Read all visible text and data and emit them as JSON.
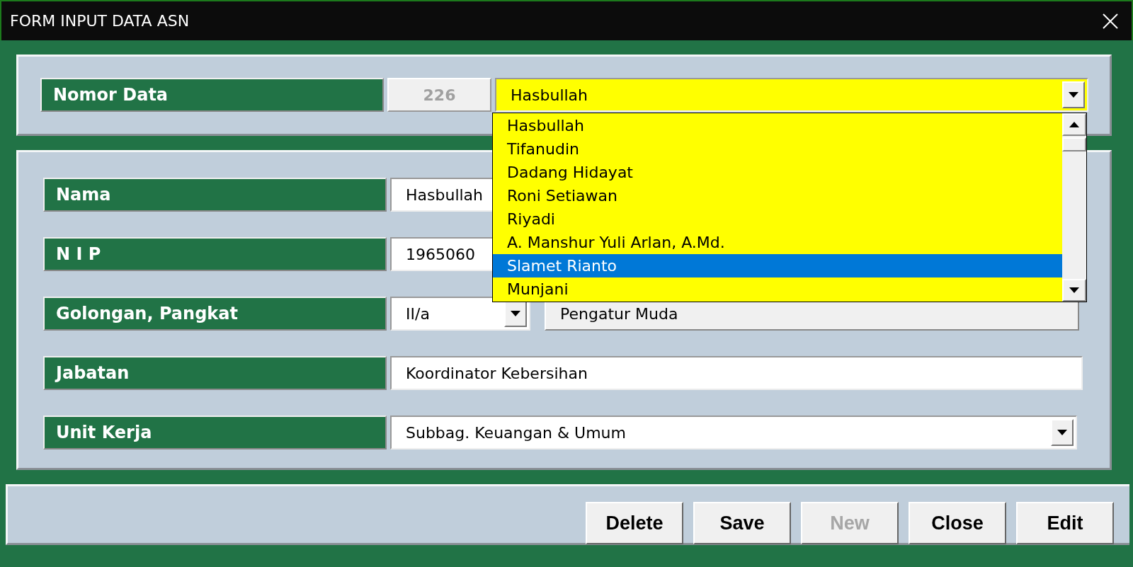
{
  "window": {
    "title": "FORM INPUT DATA ASN"
  },
  "record": {
    "label": "Nomor Data",
    "number": "226",
    "number_disabled": true,
    "name_value": "Hasbullah",
    "expanded": true
  },
  "dropdown": {
    "items": [
      {
        "label": "Hasbullah",
        "selected": false
      },
      {
        "label": "Tifanudin",
        "selected": false
      },
      {
        "label": "Dadang Hidayat",
        "selected": false
      },
      {
        "label": "Roni Setiawan",
        "selected": false
      },
      {
        "label": "Riyadi",
        "selected": false
      },
      {
        "label": "A. Manshur Yuli Arlan, A.Md.",
        "selected": false
      },
      {
        "label": "Slamet Rianto",
        "selected": true
      },
      {
        "label": "Munjani",
        "selected": false
      }
    ]
  },
  "fields": [
    {
      "kind": "text",
      "label": "Nama",
      "value": "Hasbullah"
    },
    {
      "kind": "text",
      "label": "N I P",
      "value": "1965060"
    },
    {
      "kind": "combo_pair",
      "label": "Golongan, Pangkat",
      "value": "II/a",
      "second_value": "Pengatur Muda"
    },
    {
      "kind": "text",
      "label": "Jabatan",
      "value": "Koordinator Kebersihan"
    },
    {
      "kind": "combo",
      "label": "Unit Kerja",
      "value": "Subbag. Keuangan & Umum"
    }
  ],
  "buttons": [
    {
      "label": "Delete",
      "disabled": false
    },
    {
      "label": "Save",
      "disabled": false
    },
    {
      "label": "New",
      "disabled": true
    },
    {
      "label": "Close",
      "disabled": false
    },
    {
      "label": "Edit",
      "disabled": false
    }
  ]
}
